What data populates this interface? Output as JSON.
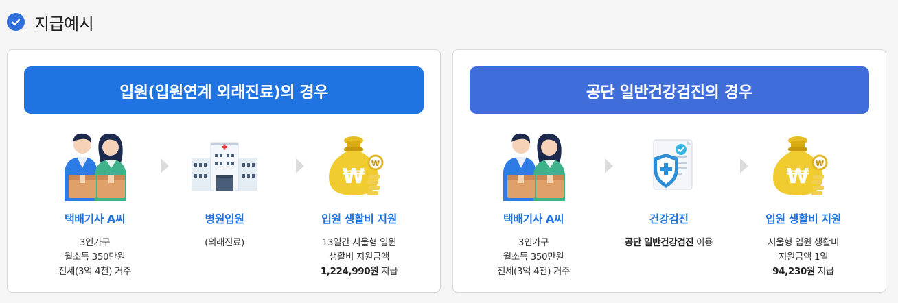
{
  "section": {
    "title": "지급예시",
    "icon": "check-circle-icon",
    "accent": "#2f6fdc"
  },
  "cards": [
    {
      "header": "입원(입원연계 외래진료)의 경우",
      "header_color": "#1f74e1",
      "steps": [
        {
          "icon": "couriers-icon",
          "title": "택배기사 A씨",
          "lines": [
            "3인가구",
            "월소득 350만원",
            "전세(3억 4천) 거주"
          ]
        },
        {
          "icon": "hospital-icon",
          "title": "병원입원",
          "lines": [
            "(외래진료)"
          ]
        },
        {
          "icon": "money-bag-icon",
          "title": "입원 생활비 지원",
          "lines": [
            "13일간 서울형 입원",
            "생활비 지원금액"
          ],
          "amount": "1,224,990원",
          "amount_suffix": " 지급"
        }
      ]
    },
    {
      "header": "공단 일반건강검진의 경우",
      "header_color": "#3f6edb",
      "steps": [
        {
          "icon": "couriers-icon",
          "title": "택배기사 A씨",
          "lines": [
            "3인가구",
            "월소득 350만원",
            "전세(3억 4천) 거주"
          ]
        },
        {
          "icon": "health-shield-document-icon",
          "title": "건강검진",
          "emph": "공단 일반건강검진",
          "emph_suffix": " 이용"
        },
        {
          "icon": "money-bag-icon",
          "title": "입원 생활비 지원",
          "lines": [
            "서울형 입원 생활비",
            "지원금액 1일"
          ],
          "amount": "94,230원",
          "amount_suffix": " 지급"
        }
      ]
    }
  ]
}
